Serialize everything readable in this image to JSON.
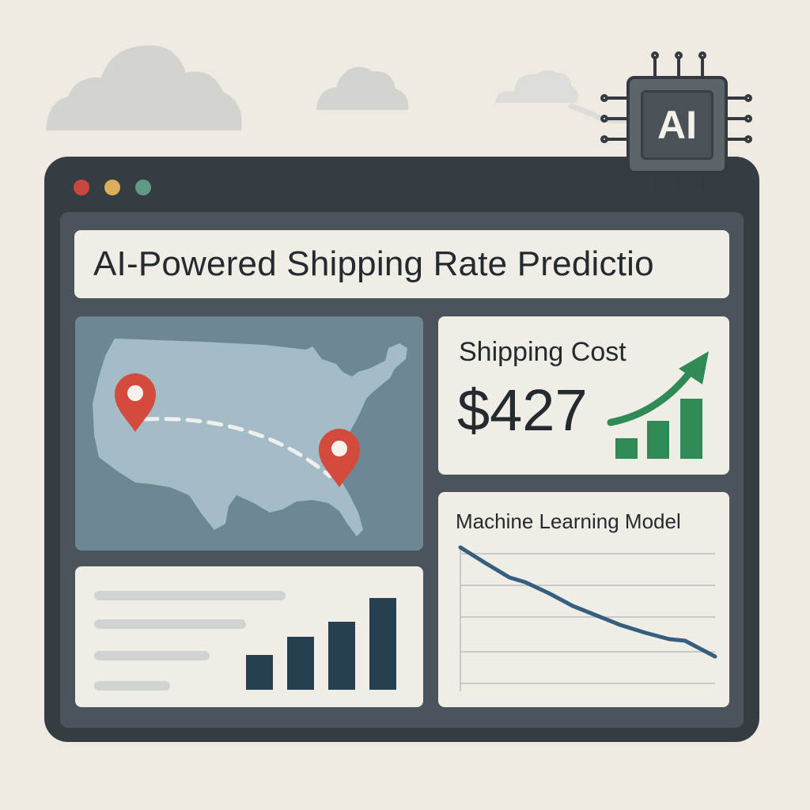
{
  "window": {
    "controls": [
      {
        "name": "close",
        "color": "#c8473f"
      },
      {
        "name": "minimize",
        "color": "#dcae5a"
      },
      {
        "name": "maximize",
        "color": "#5f9a86"
      }
    ]
  },
  "header": {
    "title": "AI-Powered Shipping Rate Predictio"
  },
  "map": {
    "icon": "us-map-icon",
    "origin_pin": "location-pin-icon",
    "destination_pin": "location-pin-icon",
    "colors": {
      "land": "#a3bcc6",
      "pin": "#d44b3e",
      "route": "#eef0ee"
    }
  },
  "cost": {
    "label": "Shipping Cost",
    "value": "$427",
    "icon": "trend-up-icon",
    "accent": "#2f8a55"
  },
  "bars_card": {
    "text_lines": 4,
    "bar_levels": [
      0.38,
      0.58,
      0.74,
      1.0
    ],
    "color": "#263f51"
  },
  "model": {
    "title": "Machine Learning Model",
    "line_color": "#345f7e",
    "trend": "decreasing"
  },
  "badge": {
    "label": "AI",
    "icon": "ai-chip-icon"
  }
}
